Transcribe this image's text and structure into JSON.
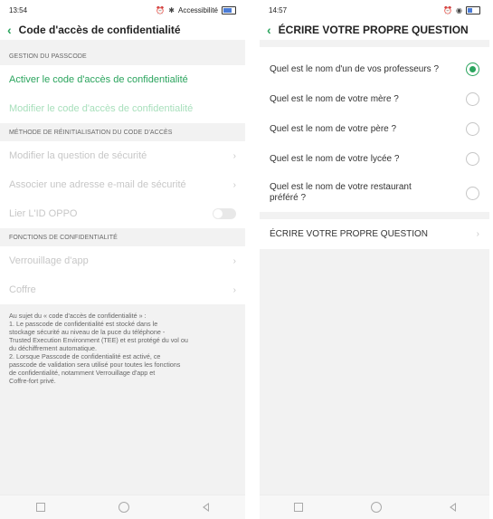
{
  "left": {
    "status": {
      "time": "13:54",
      "right_text": "Accessibilité"
    },
    "appbar": {
      "title": "Code d'accès de confidentialité"
    },
    "sections": [
      {
        "header": "GESTION DU PASSCODE",
        "items": [
          {
            "label": "Activer le code d'accès de confidentialité"
          },
          {
            "label": "Modifier le code d'accès de confidentialité"
          }
        ]
      },
      {
        "header": "MÉTHODE DE RÉINITIALISATION DU CODE D'ACCÈS",
        "items": [
          {
            "label": "Modifier la question de sécurité"
          },
          {
            "label": "Associer une adresse e-mail de sécurité"
          },
          {
            "label": "Lier L'ID OPPO"
          }
        ]
      },
      {
        "header": "FONCTIONS DE CONFIDENTIALITÉ",
        "items": [
          {
            "label": "Verrouillage d'app"
          },
          {
            "label": "Coffre"
          }
        ]
      }
    ],
    "info": [
      "Au sujet du « code d'accès de confidentialité » :",
      "1. Le passcode de confidentialité est stocké dans le",
      "stockage sécurité au niveau de la puce du téléphone -",
      "Trusted Execution Environment (TEE) et est protégé du vol ou",
      "du déchiffrement automatique.",
      "2. Lorsque Passcode de confidentialité est activé, ce",
      "passcode de validation sera utilisé pour toutes les fonctions",
      "de confidentialité, notamment Verrouillage d'app et",
      "Coffre-fort privé."
    ]
  },
  "right": {
    "status": {
      "time": "14:57"
    },
    "appbar": {
      "title": "ÉCRIRE VOTRE PROPRE QUESTION"
    },
    "questions": [
      {
        "text": "Quel est le nom d'un de vos professeurs ?",
        "checked": true
      },
      {
        "text": "Quel est le nom de votre mère ?",
        "checked": false
      },
      {
        "text": "Quel est le nom de votre père ?",
        "checked": false
      },
      {
        "text": "Quel est le nom de votre lycée ?",
        "checked": false
      },
      {
        "text": "Quel est le nom de votre restaurant préféré ?",
        "checked": false
      }
    ],
    "own_question": {
      "label": "ÉCRIRE VOTRE PROPRE QUESTION"
    }
  },
  "colors": {
    "accent": "#2aa45d",
    "accent_light": "#a7dfbb",
    "disabled": "#c7c7c7",
    "background": "#f2f2f2"
  },
  "icons": [
    "back-chevron-icon",
    "chevron-right-icon",
    "toggle-icon",
    "radio-icon",
    "nav-square-icon",
    "nav-circle-icon",
    "nav-back-icon",
    "battery-icon"
  ]
}
